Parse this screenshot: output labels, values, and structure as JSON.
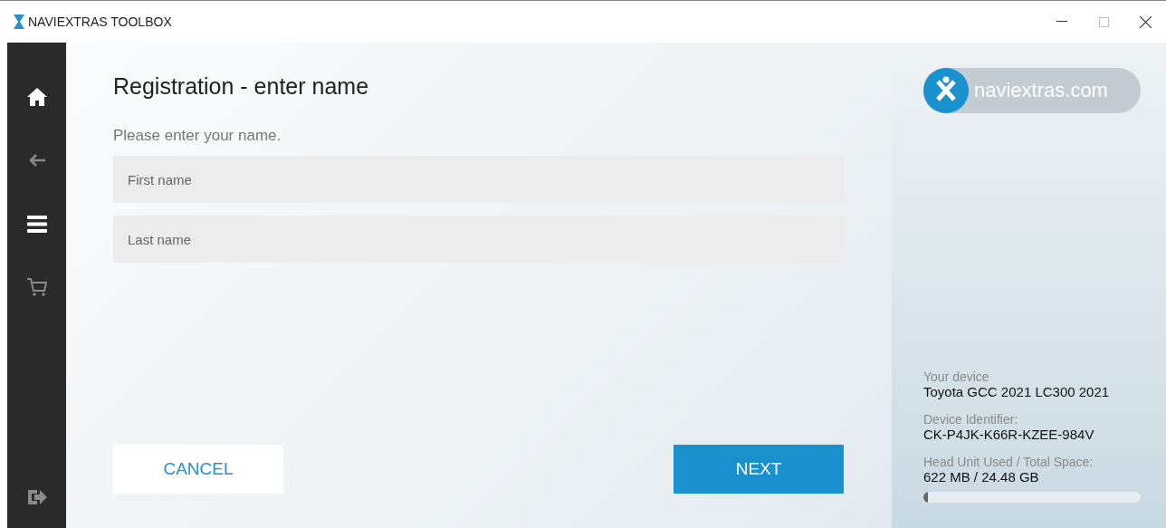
{
  "window": {
    "title": "NAVIEXTRAS TOOLBOX"
  },
  "sidebar": {
    "items": [
      {
        "kind": "home",
        "enabled": true
      },
      {
        "kind": "back",
        "enabled": false
      },
      {
        "kind": "menu",
        "enabled": true
      },
      {
        "kind": "cart",
        "enabled": false
      }
    ],
    "bottom": {
      "kind": "exit",
      "enabled": false
    }
  },
  "page": {
    "title": "Registration - enter name",
    "prompt": "Please enter your name.",
    "fields": [
      {
        "placeholder": "First name"
      },
      {
        "placeholder": "Last name"
      }
    ],
    "buttons": [
      {
        "kind": "secondary",
        "label": "CANCEL"
      },
      {
        "kind": "primary",
        "label": "NEXT"
      }
    ]
  },
  "brand": {
    "label": "naviextras.com"
  },
  "device": [
    {
      "label": "Your device",
      "value": "Toyota GCC 2021 LC300 2021"
    },
    {
      "label": "Device Identifier:",
      "value": "CK-P4JK-K66R-KZEE-984V"
    },
    {
      "label": "Head Unit Used / Total Space:",
      "value": "622 MB / 24.48 GB"
    }
  ],
  "storage": {
    "level": 0.02
  }
}
